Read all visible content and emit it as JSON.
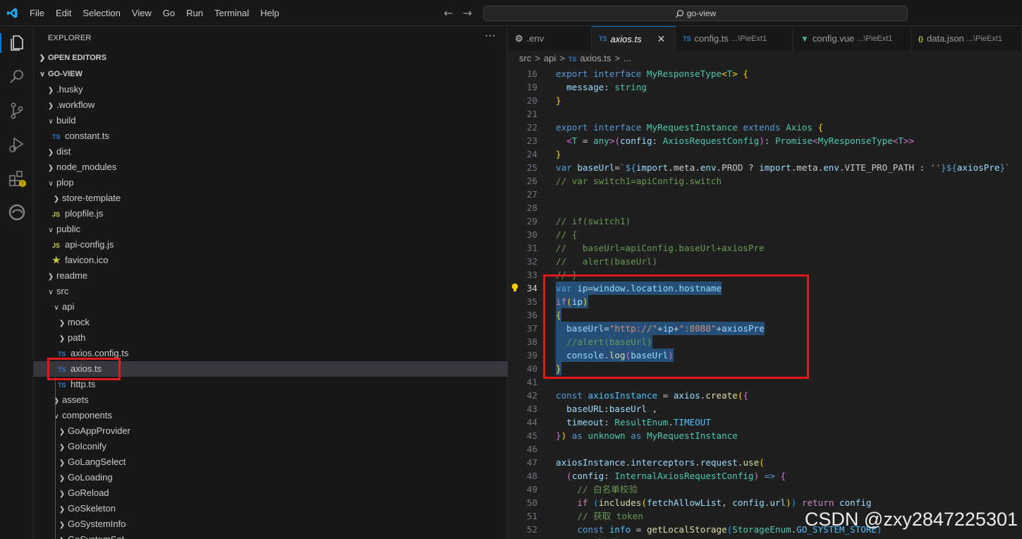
{
  "menu": [
    "File",
    "Edit",
    "Selection",
    "View",
    "Go",
    "Run",
    "Terminal",
    "Help"
  ],
  "search": {
    "text": "go-view"
  },
  "explorer": {
    "title": "EXPLORER",
    "open_editors": "OPEN EDITORS",
    "project": "GO-VIEW",
    "tree": [
      {
        "label": ".husky",
        "kind": "folder",
        "open": false,
        "depth": 1
      },
      {
        "label": ".workflow",
        "kind": "folder",
        "open": false,
        "depth": 1
      },
      {
        "label": "build",
        "kind": "folder",
        "open": true,
        "depth": 1
      },
      {
        "label": "constant.ts",
        "kind": "ts",
        "depth": 2
      },
      {
        "label": "dist",
        "kind": "folder",
        "open": false,
        "depth": 1
      },
      {
        "label": "node_modules",
        "kind": "folder",
        "open": false,
        "depth": 1
      },
      {
        "label": "plop",
        "kind": "folder",
        "open": true,
        "depth": 1
      },
      {
        "label": "store-template",
        "kind": "folder",
        "open": false,
        "depth": 2
      },
      {
        "label": "plopfile.js",
        "kind": "js",
        "depth": 2
      },
      {
        "label": "public",
        "kind": "folder",
        "open": true,
        "depth": 1
      },
      {
        "label": "api-config.js",
        "kind": "js",
        "depth": 2
      },
      {
        "label": "favicon.ico",
        "kind": "star",
        "depth": 2
      },
      {
        "label": "readme",
        "kind": "folder",
        "open": false,
        "depth": 1
      },
      {
        "label": "src",
        "kind": "folder",
        "open": true,
        "depth": 1
      },
      {
        "label": "api",
        "kind": "folder",
        "open": true,
        "depth": 2
      },
      {
        "label": "mock",
        "kind": "folder",
        "open": false,
        "depth": 3
      },
      {
        "label": "path",
        "kind": "folder",
        "open": false,
        "depth": 3
      },
      {
        "label": "axios.config.ts",
        "kind": "ts",
        "depth": 3
      },
      {
        "label": "axios.ts",
        "kind": "ts",
        "depth": 3,
        "selected": true
      },
      {
        "label": "http.ts",
        "kind": "ts",
        "depth": 3
      },
      {
        "label": "assets",
        "kind": "folder",
        "open": false,
        "depth": 2
      },
      {
        "label": "components",
        "kind": "folder",
        "open": true,
        "depth": 2
      },
      {
        "label": "GoAppProvider",
        "kind": "folder",
        "open": false,
        "depth": 3
      },
      {
        "label": "GoIconify",
        "kind": "folder",
        "open": false,
        "depth": 3
      },
      {
        "label": "GoLangSelect",
        "kind": "folder",
        "open": false,
        "depth": 3
      },
      {
        "label": "GoLoading",
        "kind": "folder",
        "open": false,
        "depth": 3
      },
      {
        "label": "GoReload",
        "kind": "folder",
        "open": false,
        "depth": 3
      },
      {
        "label": "GoSkeleton",
        "kind": "folder",
        "open": false,
        "depth": 3
      },
      {
        "label": "GoSystemInfo",
        "kind": "folder",
        "open": false,
        "depth": 3
      },
      {
        "label": "GoSystemSet",
        "kind": "folder",
        "open": false,
        "depth": 3
      }
    ]
  },
  "tabs": [
    {
      "icon": "gear-icon",
      "label": ".env",
      "sub": ""
    },
    {
      "icon": "TS",
      "label": "axios.ts",
      "sub": "",
      "active": true
    },
    {
      "icon": "TS",
      "label": "config.ts",
      "sub": "...\\PieExt1"
    },
    {
      "icon": "vue-icon",
      "label": "config.vue",
      "sub": "...\\PieExt1"
    },
    {
      "icon": "{}",
      "label": "data.json",
      "sub": "...\\PieExt1"
    }
  ],
  "breadcrumb": [
    "src",
    ">",
    "api",
    ">",
    "TS",
    "axios.ts",
    ">",
    "..."
  ],
  "code": [
    {
      "n": "16",
      "t": [
        [
          "k",
          "export "
        ],
        [
          "k",
          "interface "
        ],
        [
          "ty",
          "MyResponseType"
        ],
        [
          "b1",
          "<"
        ],
        [
          "ty",
          "T"
        ],
        [
          "b1",
          "> "
        ],
        [
          "b1",
          "{"
        ]
      ]
    },
    {
      "n": "19",
      "t": [
        [
          "",
          "  "
        ],
        [
          "v",
          "message"
        ],
        [
          "",
          ": "
        ],
        [
          "ty",
          "string"
        ]
      ]
    },
    {
      "n": "20",
      "t": [
        [
          "b1",
          "}"
        ]
      ]
    },
    {
      "n": "21",
      "t": []
    },
    {
      "n": "22",
      "t": [
        [
          "k",
          "export "
        ],
        [
          "k",
          "interface "
        ],
        [
          "ty",
          "MyRequestInstance "
        ],
        [
          "k",
          "extends "
        ],
        [
          "ty",
          "Axios "
        ],
        [
          "b1",
          "{"
        ]
      ]
    },
    {
      "n": "23",
      "t": [
        [
          "",
          "  "
        ],
        [
          "b2",
          "<"
        ],
        [
          "ty",
          "T"
        ],
        [
          "",
          " = "
        ],
        [
          "ty",
          "any"
        ],
        [
          "b2",
          ">"
        ],
        [
          "b2",
          "("
        ],
        [
          "v",
          "config"
        ],
        [
          "",
          ": "
        ],
        [
          "ty",
          "AxiosRequestConfig"
        ],
        [
          "b2",
          ")"
        ],
        [
          "",
          ": "
        ],
        [
          "ty",
          "Promise"
        ],
        [
          "b2",
          "<"
        ],
        [
          "ty",
          "MyResponseType"
        ],
        [
          "b2",
          "<"
        ],
        [
          "ty",
          "T"
        ],
        [
          "b2",
          ">>"
        ]
      ]
    },
    {
      "n": "24",
      "t": [
        [
          "b1",
          "}"
        ]
      ]
    },
    {
      "n": "25",
      "t": [
        [
          "k",
          "var "
        ],
        [
          "v",
          "baseUrl"
        ],
        [
          "",
          "="
        ],
        [
          "s",
          "`"
        ],
        [
          "k",
          "${"
        ],
        [
          "v",
          "import"
        ],
        [
          "",
          ".meta."
        ],
        [
          "v",
          "env"
        ],
        [
          "",
          ".PROD ? "
        ],
        [
          "v",
          "import"
        ],
        [
          "",
          ".meta."
        ],
        [
          "v",
          "env"
        ],
        [
          "",
          ".VITE_PRO_PATH : "
        ],
        [
          "s",
          "''"
        ],
        [
          "k",
          "}${"
        ],
        [
          "v",
          "axiosPre"
        ],
        [
          "k",
          "}"
        ],
        [
          "s",
          "`"
        ]
      ]
    },
    {
      "n": "26",
      "t": [
        [
          "c",
          "// var switch1=apiConfig.switch"
        ]
      ]
    },
    {
      "n": "27",
      "t": []
    },
    {
      "n": "28",
      "t": []
    },
    {
      "n": "29",
      "t": [
        [
          "c",
          "// if(switch1)"
        ]
      ]
    },
    {
      "n": "30",
      "t": [
        [
          "c",
          "// {"
        ]
      ]
    },
    {
      "n": "31",
      "t": [
        [
          "c",
          "//   baseUrl=apiConfig.baseUrl+axiosPre"
        ]
      ]
    },
    {
      "n": "32",
      "t": [
        [
          "c",
          "//   alert(baseUrl)"
        ]
      ]
    },
    {
      "n": "33",
      "t": [
        [
          "c",
          "// }"
        ]
      ]
    },
    {
      "n": "34",
      "t": [
        [
          "k",
          "var "
        ],
        [
          "v",
          "ip"
        ],
        [
          "",
          "="
        ],
        [
          "v",
          "window"
        ],
        [
          "",
          "."
        ],
        [
          "v",
          "location"
        ],
        [
          "",
          "."
        ],
        [
          "v",
          "hostname"
        ]
      ],
      "hl": true,
      "cur": true,
      "bulb": true
    },
    {
      "n": "35",
      "t": [
        [
          "kc",
          "if"
        ],
        [
          "b1",
          "("
        ],
        [
          "v",
          "ip"
        ],
        [
          "b1",
          ")"
        ]
      ],
      "hl": true
    },
    {
      "n": "36",
      "t": [
        [
          "b1",
          "{"
        ]
      ],
      "hl": true
    },
    {
      "n": "37",
      "t": [
        [
          "",
          "  "
        ],
        [
          "v",
          "baseUrl"
        ],
        [
          "",
          "="
        ],
        [
          "s",
          "\"http://\""
        ],
        [
          "",
          "+"
        ],
        [
          "v",
          "ip"
        ],
        [
          "",
          "+"
        ],
        [
          "s",
          "\":8080\""
        ],
        [
          "",
          "+"
        ],
        [
          "v",
          "axiosPre"
        ]
      ],
      "hl": true
    },
    {
      "n": "38",
      "t": [
        [
          "",
          "  "
        ],
        [
          "c",
          "//alert(baseUrl)"
        ]
      ],
      "hl": true
    },
    {
      "n": "39",
      "t": [
        [
          "",
          "  "
        ],
        [
          "v",
          "console"
        ],
        [
          "",
          "."
        ],
        [
          "f",
          "log"
        ],
        [
          "b2",
          "("
        ],
        [
          "v",
          "baseUrl"
        ],
        [
          "b2",
          ")"
        ]
      ],
      "hl": true
    },
    {
      "n": "40",
      "t": [
        [
          "b1",
          "}"
        ]
      ],
      "hl": true
    },
    {
      "n": "41",
      "t": []
    },
    {
      "n": "42",
      "t": [
        [
          "k",
          "const "
        ],
        [
          "vl",
          "axiosInstance"
        ],
        [
          "",
          " = "
        ],
        [
          "v",
          "axios"
        ],
        [
          "",
          "."
        ],
        [
          "f",
          "create"
        ],
        [
          "b1",
          "("
        ],
        [
          "b2",
          "{"
        ]
      ]
    },
    {
      "n": "43",
      "t": [
        [
          "",
          "  "
        ],
        [
          "v",
          "baseURL"
        ],
        [
          "",
          ":"
        ],
        [
          "v",
          "baseUrl"
        ],
        [
          "",
          " ,"
        ]
      ]
    },
    {
      "n": "44",
      "t": [
        [
          "",
          "  "
        ],
        [
          "v",
          "timeout"
        ],
        [
          "",
          ": "
        ],
        [
          "ty",
          "ResultEnum"
        ],
        [
          "",
          "."
        ],
        [
          "vl",
          "TIMEOUT"
        ]
      ]
    },
    {
      "n": "45",
      "t": [
        [
          "b2",
          "}"
        ],
        [
          "b1",
          ")"
        ],
        [
          "",
          " "
        ],
        [
          "k",
          "as "
        ],
        [
          "ty",
          "unknown "
        ],
        [
          "k",
          "as "
        ],
        [
          "ty",
          "MyRequestInstance"
        ]
      ]
    },
    {
      "n": "46",
      "t": []
    },
    {
      "n": "47",
      "t": [
        [
          "v",
          "axiosInstance"
        ],
        [
          "",
          "."
        ],
        [
          "v",
          "interceptors"
        ],
        [
          "",
          "."
        ],
        [
          "v",
          "request"
        ],
        [
          "",
          "."
        ],
        [
          "f",
          "use"
        ],
        [
          "b1",
          "("
        ]
      ]
    },
    {
      "n": "48",
      "t": [
        [
          "",
          "  "
        ],
        [
          "b2",
          "("
        ],
        [
          "v",
          "config"
        ],
        [
          "",
          ": "
        ],
        [
          "ty",
          "InternalAxiosRequestConfig"
        ],
        [
          "b2",
          ")"
        ],
        [
          "",
          " "
        ],
        [
          "k",
          "=>"
        ],
        [
          "",
          " "
        ],
        [
          "b2",
          "{"
        ]
      ]
    },
    {
      "n": "49",
      "t": [
        [
          "",
          "    "
        ],
        [
          "c",
          "// 白名单校验"
        ]
      ]
    },
    {
      "n": "50",
      "t": [
        [
          "",
          "    "
        ],
        [
          "kc",
          "if "
        ],
        [
          "b3",
          "("
        ],
        [
          "f",
          "includes"
        ],
        [
          "b1",
          "("
        ],
        [
          "v",
          "fetchAllowList"
        ],
        [
          "",
          ", "
        ],
        [
          "v",
          "config"
        ],
        [
          "",
          "."
        ],
        [
          "v",
          "url"
        ],
        [
          "b1",
          ")"
        ],
        [
          "b3",
          ")"
        ],
        [
          "",
          " "
        ],
        [
          "kc",
          "return "
        ],
        [
          "v",
          "config"
        ]
      ]
    },
    {
      "n": "51",
      "t": [
        [
          "",
          "    "
        ],
        [
          "c",
          "// 获取 token"
        ]
      ]
    },
    {
      "n": "52",
      "t": [
        [
          "",
          "    "
        ],
        [
          "k",
          "const "
        ],
        [
          "vl",
          "info"
        ],
        [
          "",
          " = "
        ],
        [
          "f",
          "getLocalStorage"
        ],
        [
          "b3",
          "("
        ],
        [
          "ty",
          "StorageEnum"
        ],
        [
          "",
          "."
        ],
        [
          "vl",
          "GO_SYSTEM_STORE"
        ],
        [
          "b3",
          ")"
        ]
      ]
    },
    {
      "n": "53",
      "t": [
        [
          "",
          "    "
        ],
        [
          "c",
          "// 重新登录"
        ]
      ]
    }
  ],
  "watermark": "CSDN @zxy2847225301",
  "colors": {
    "accent": "#0078d4",
    "highlight_box": "#e0191b",
    "selection": "#264f78"
  }
}
